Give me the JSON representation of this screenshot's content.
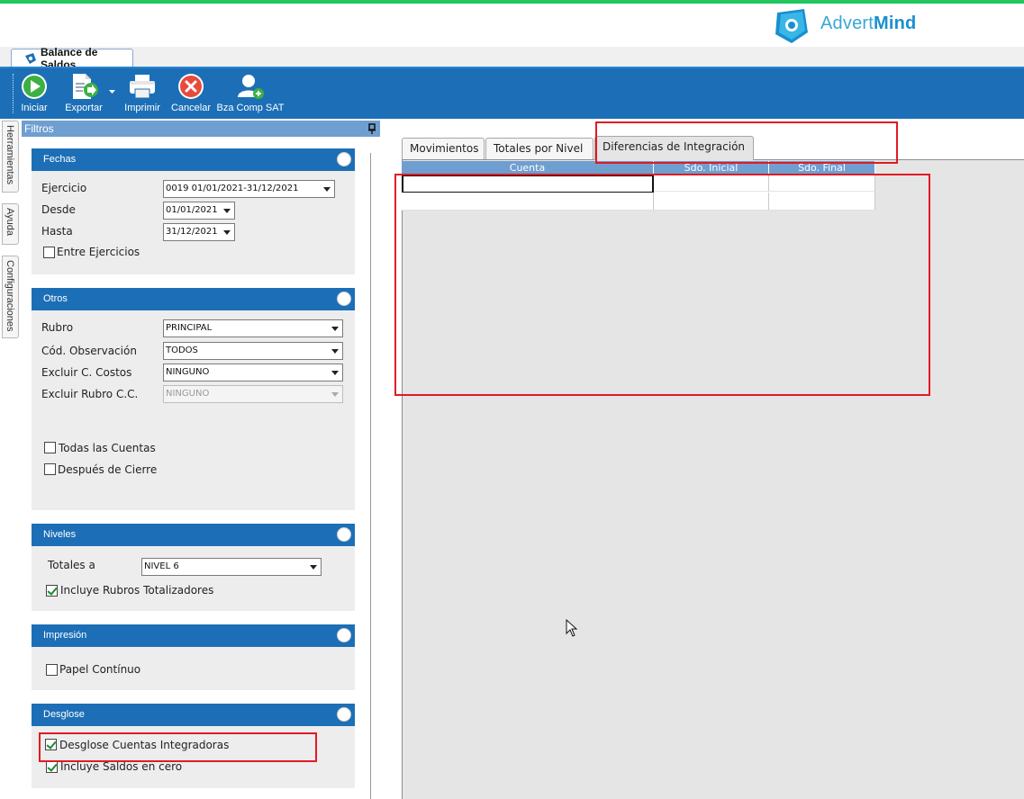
{
  "brand": {
    "prefix": "Advert",
    "suffix": "Mind"
  },
  "document_tab": {
    "label": "Balance de Saldos"
  },
  "toolbar": {
    "buttons": [
      {
        "label": "Iniciar",
        "icon": "play-icon"
      },
      {
        "label": "Exportar",
        "icon": "export-icon"
      },
      {
        "label": "Imprimir",
        "icon": "printer-icon"
      },
      {
        "label": "Cancelar",
        "icon": "cancel-icon"
      },
      {
        "label": "Bza Comp SAT",
        "icon": "add-user-icon"
      }
    ]
  },
  "side_tabs": [
    "Herramientas",
    "Ayuda",
    "Configuraciones"
  ],
  "filters": {
    "title": "Filtros",
    "fechas": {
      "title": "Fechas",
      "ejercicio_label": "Ejercicio",
      "ejercicio_value": "0019 01/01/2021-31/12/2021",
      "desde_label": "Desde",
      "desde_value": "01/01/2021",
      "hasta_label": "Hasta",
      "hasta_value": "31/12/2021",
      "entre_label": "Entre Ejercicios",
      "entre_checked": false
    },
    "otros": {
      "title": "Otros",
      "rubro_label": "Rubro",
      "rubro_value": "PRINCIPAL",
      "cod_obs_label": "Cód. Observación",
      "cod_obs_value": "TODOS",
      "excluir_cc_label": "Excluir C. Costos",
      "excluir_cc_value": "NINGUNO",
      "excluir_rubro_label": "Excluir Rubro C.C.",
      "excluir_rubro_value": "NINGUNO",
      "todas_label": "Todas las Cuentas",
      "todas_checked": false,
      "despues_label": "Después de Cierre",
      "despues_checked": false
    },
    "niveles": {
      "title": "Niveles",
      "totales_label": "Totales a",
      "totales_value": "NIVEL 6",
      "incluye_label": "Incluye Rubros Totalizadores",
      "incluye_checked": true
    },
    "impresion": {
      "title": "Impresión",
      "papel_label": "Papel Contínuo",
      "papel_checked": false
    },
    "desglose": {
      "title": "Desglose",
      "desglose_label": "Desglose Cuentas Integradoras",
      "desglose_checked": true,
      "saldos_label": "Incluye Saldos en cero",
      "saldos_checked": true
    }
  },
  "result_tabs": [
    "Movimientos",
    "Totales por Nivel",
    "Diferencias de Integración"
  ],
  "active_tab": "Diferencias de Integración",
  "grid": {
    "columns": [
      "Cuenta",
      "Sdo. Inicial",
      "Sdo. Final"
    ]
  },
  "colors": {
    "toolbar": "#1c6fb6",
    "accent_green": "#22c55e",
    "highlight_red": "#e01b24",
    "brand_blue": "#1a8fd0"
  }
}
